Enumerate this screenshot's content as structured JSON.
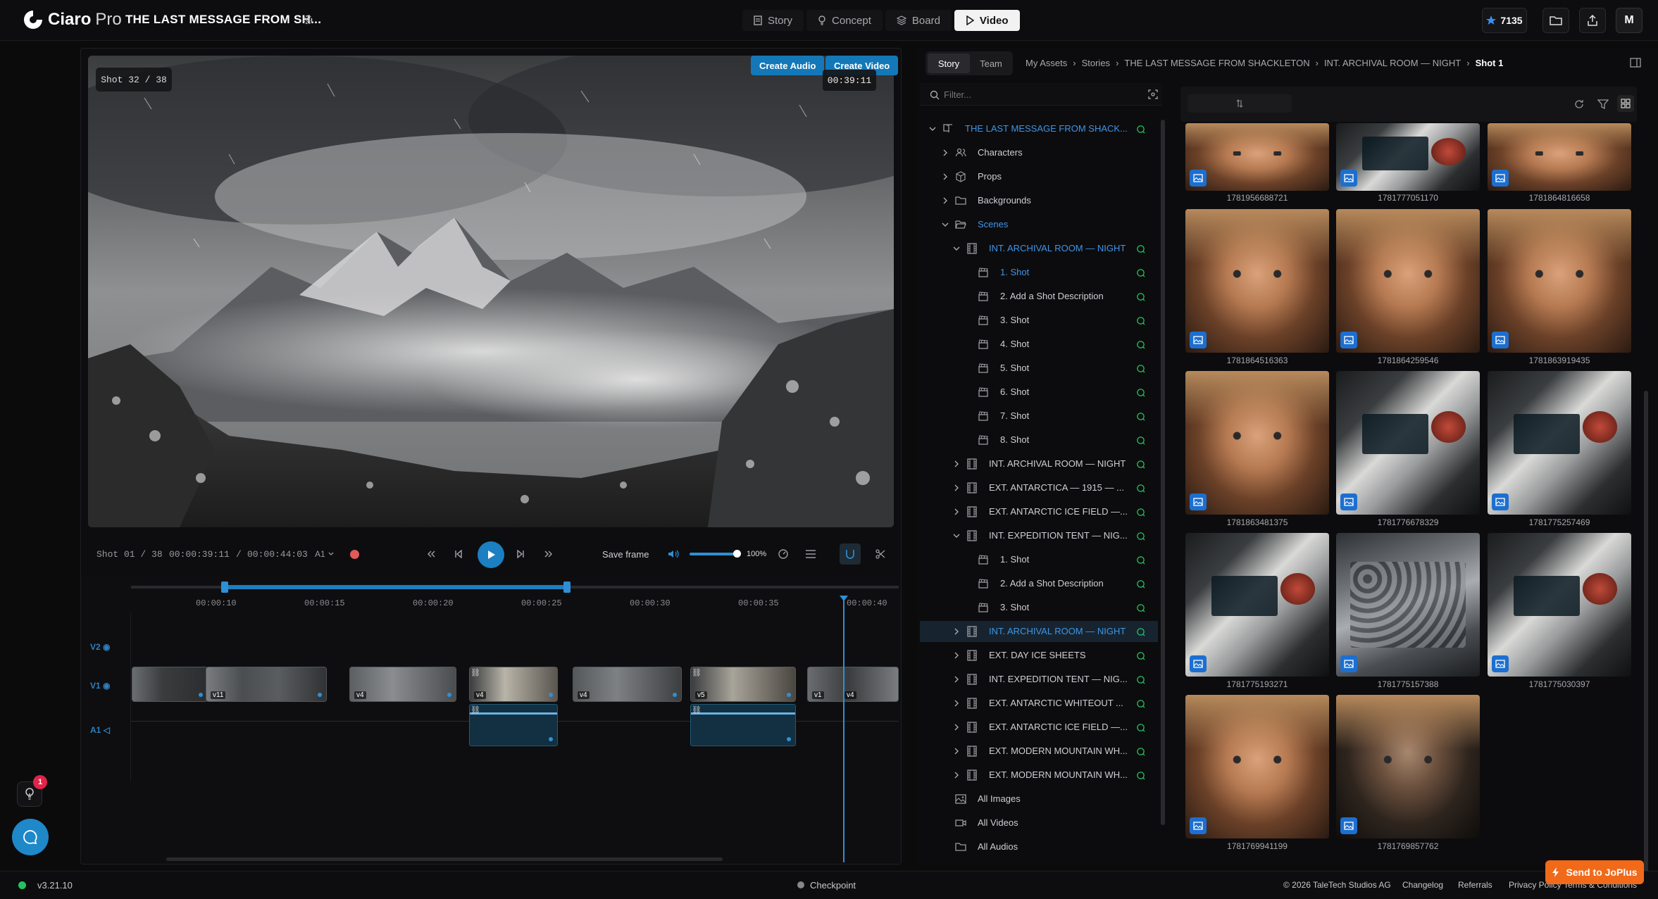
{
  "app": {
    "brand": "Ciaro",
    "brand_suffix": "Pro",
    "project_title": "THE LAST MESSAGE FROM SH..."
  },
  "modes": [
    {
      "label": "Story"
    },
    {
      "label": "Concept"
    },
    {
      "label": "Board"
    },
    {
      "label": "Video",
      "active": true
    }
  ],
  "header": {
    "credits": "7135",
    "avatar_initial": "M"
  },
  "leftrail": {
    "hint_badge": "1"
  },
  "player": {
    "shot_badge": "Shot 32 / 38",
    "create_audio": "Create Audio",
    "create_video": "Create Video",
    "timecode": "00:39:11"
  },
  "controls": {
    "shot_info": "Shot 01 / 38",
    "time_current": "00:00:39:11",
    "time_total": "00:00:44:03",
    "audio_track": "A1",
    "save_frame": "Save frame",
    "volume_pct": "100%",
    "volume_level": 1.0
  },
  "timeline": {
    "ruler": [
      "00:00:10",
      "00:00:15",
      "00:00:20",
      "00:00:25",
      "00:00:30",
      "00:00:35",
      "00:00:40"
    ],
    "tracks": [
      "V2",
      "V1",
      "A1"
    ],
    "clip_labels": [
      "v11",
      "v4",
      "v4",
      "v4",
      "v5",
      "v1",
      "v4"
    ]
  },
  "rightpanel": {
    "tabs": [
      "Story",
      "Team"
    ],
    "breadcrumb": [
      "My Assets",
      "Stories",
      "THE LAST MESSAGE FROM SHACKLETON",
      "INT. ARCHIVAL ROOM — NIGHT",
      "Shot 1"
    ],
    "filter_placeholder": "Filter...",
    "tree": [
      {
        "label": "THE LAST MESSAGE FROM SHACK...",
        "depth": 0,
        "icon": "book",
        "blue": true,
        "sync": true,
        "chev": "down"
      },
      {
        "label": "Characters",
        "depth": 1,
        "icon": "users",
        "chev": "right"
      },
      {
        "label": "Props",
        "depth": 1,
        "icon": "box",
        "chev": "right"
      },
      {
        "label": "Backgrounds",
        "depth": 1,
        "icon": "folder",
        "chev": "right"
      },
      {
        "label": "Scenes",
        "depth": 1,
        "icon": "folder-open",
        "chev": "down",
        "blue": true
      },
      {
        "label": "INT. ARCHIVAL ROOM — NIGHT",
        "depth": 2,
        "icon": "film",
        "chev": "down",
        "blue": true,
        "sync": true
      },
      {
        "label": "1. Shot",
        "depth": 3,
        "icon": "clap",
        "blue": true,
        "sync": true
      },
      {
        "label": "2. Add a Shot Description",
        "depth": 3,
        "icon": "clap",
        "sync": true
      },
      {
        "label": "3. Shot",
        "depth": 3,
        "icon": "clap",
        "sync": true
      },
      {
        "label": "4. Shot",
        "depth": 3,
        "icon": "clap",
        "sync": true
      },
      {
        "label": "5. Shot",
        "depth": 3,
        "icon": "clap",
        "sync": true
      },
      {
        "label": "6. Shot",
        "depth": 3,
        "icon": "clap",
        "sync": true
      },
      {
        "label": "7. Shot",
        "depth": 3,
        "icon": "clap",
        "sync": true
      },
      {
        "label": "8. Shot",
        "depth": 3,
        "icon": "clap",
        "sync": true
      },
      {
        "label": "INT. ARCHIVAL ROOM — NIGHT",
        "depth": 2,
        "icon": "film",
        "chev": "right",
        "sync": true
      },
      {
        "label": "EXT. ANTARCTICA — 1915 — ...",
        "depth": 2,
        "icon": "film",
        "chev": "right",
        "sync": true
      },
      {
        "label": "EXT. ANTARCTIC ICE FIELD —...",
        "depth": 2,
        "icon": "film",
        "chev": "right",
        "sync": true
      },
      {
        "label": "INT. EXPEDITION TENT — NIG...",
        "depth": 2,
        "icon": "film",
        "chev": "down",
        "sync": true
      },
      {
        "label": "1. Shot",
        "depth": 3,
        "icon": "clap",
        "sync": true
      },
      {
        "label": "2. Add a Shot Description",
        "depth": 3,
        "icon": "clap",
        "sync": true
      },
      {
        "label": "3. Shot",
        "depth": 3,
        "icon": "clap",
        "sync": true
      },
      {
        "label": "INT. ARCHIVAL ROOM — NIGHT",
        "depth": 2,
        "icon": "film",
        "chev": "right",
        "blue": true,
        "sel": true,
        "sync": true
      },
      {
        "label": "EXT. DAY ICE SHEETS",
        "depth": 2,
        "icon": "film",
        "chev": "right",
        "sync": true
      },
      {
        "label": "INT. EXPEDITION TENT — NIG...",
        "depth": 2,
        "icon": "film",
        "chev": "right",
        "sync": true
      },
      {
        "label": "EXT. ANTARCTIC WHITEOUT ...",
        "depth": 2,
        "icon": "film",
        "chev": "right",
        "sync": true
      },
      {
        "label": "EXT. ANTARCTIC ICE FIELD —...",
        "depth": 2,
        "icon": "film",
        "chev": "right",
        "sync": true
      },
      {
        "label": "EXT. MODERN MOUNTAIN WH...",
        "depth": 2,
        "icon": "film",
        "chev": "right",
        "sync": true
      },
      {
        "label": "EXT. MODERN MOUNTAIN WH...",
        "depth": 2,
        "icon": "film",
        "chev": "right",
        "sync": true
      },
      {
        "label": "All Images",
        "depth": 1,
        "icon": "image"
      },
      {
        "label": "All Videos",
        "depth": 1,
        "icon": "video"
      },
      {
        "label": "All Audios",
        "depth": 1,
        "icon": "folder"
      }
    ],
    "grid_sort_icon": "sort-icon",
    "assets": [
      {
        "id": "1781956688721",
        "kind": "face"
      },
      {
        "id": "1781777051170",
        "kind": "device"
      },
      {
        "id": "1781864816658",
        "kind": "face"
      },
      {
        "id": "1781864516363",
        "kind": "face"
      },
      {
        "id": "1781864259546",
        "kind": "face"
      },
      {
        "id": "1781863919435",
        "kind": "face"
      },
      {
        "id": "1781863481375",
        "kind": "face"
      },
      {
        "id": "1781776678329",
        "kind": "device"
      },
      {
        "id": "1781775257469",
        "kind": "device"
      },
      {
        "id": "1781775193271",
        "kind": "device"
      },
      {
        "id": "1781775157388",
        "kind": "mixer"
      },
      {
        "id": "1781775030397",
        "kind": "device"
      },
      {
        "id": "1781769941199",
        "kind": "face"
      },
      {
        "id": "1781769857762",
        "kind": "face-dark"
      }
    ]
  },
  "status": {
    "version": "v3.21.10",
    "checkpoint": "Checkpoint",
    "copyright": "© 2026 TaleTech Studios AG",
    "links": [
      "Changelog",
      "Referrals",
      "Privacy Policy",
      "Terms & Conditions"
    ],
    "send_label": "Send to JoPlus"
  }
}
